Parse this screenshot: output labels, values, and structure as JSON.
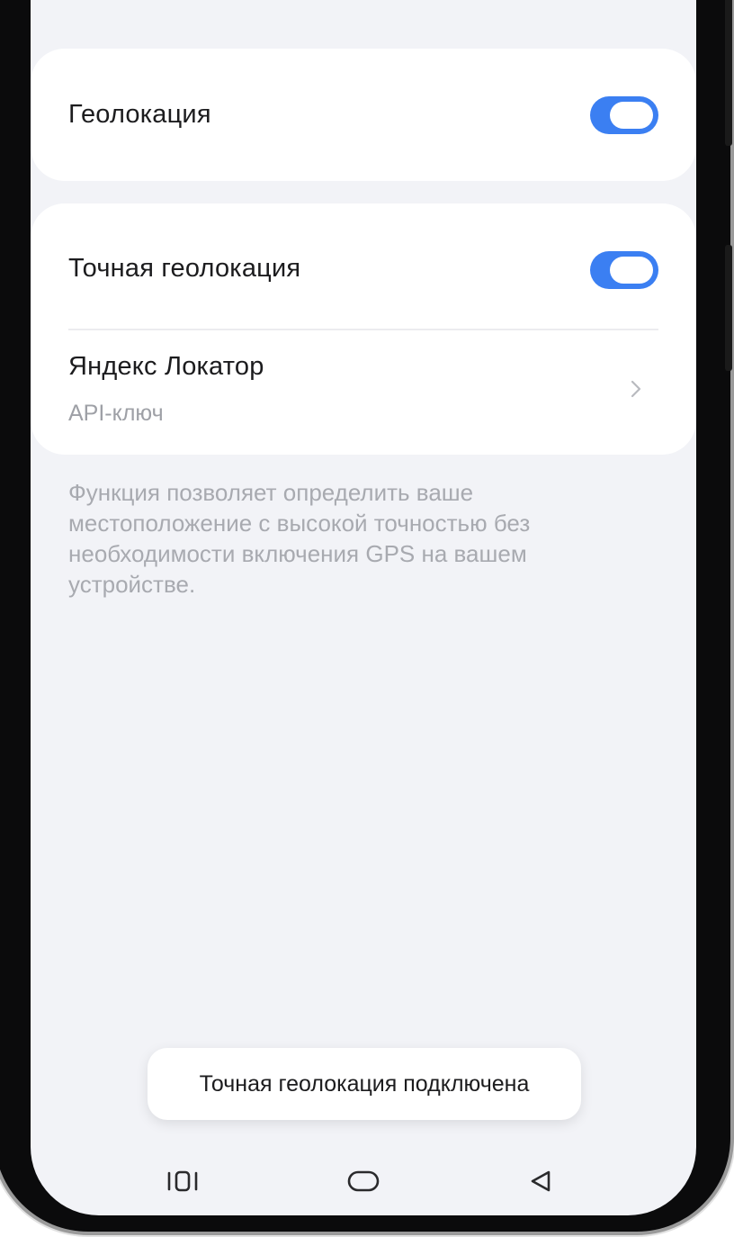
{
  "location_card": {
    "label": "Геолокация",
    "toggle_on": true
  },
  "precise_card": {
    "precise_label": "Точная геолокация",
    "precise_toggle_on": true,
    "locator_title": "Яндекс Локатор",
    "locator_subtitle": "API-ключ"
  },
  "description": "Функция позволяет определить ваше местоположение с высокой точностью без необходимости включения GPS на вашем устройстве.",
  "toast": {
    "message": "Точная геолокация подключена"
  },
  "navbar": {
    "icons": [
      "recents-icon",
      "home-icon",
      "back-icon"
    ]
  },
  "colors": {
    "accent": "#3b7ff2",
    "screen_bg": "#f2f3f7",
    "card_bg": "#ffffff",
    "secondary_text": "#9ea0a6"
  }
}
